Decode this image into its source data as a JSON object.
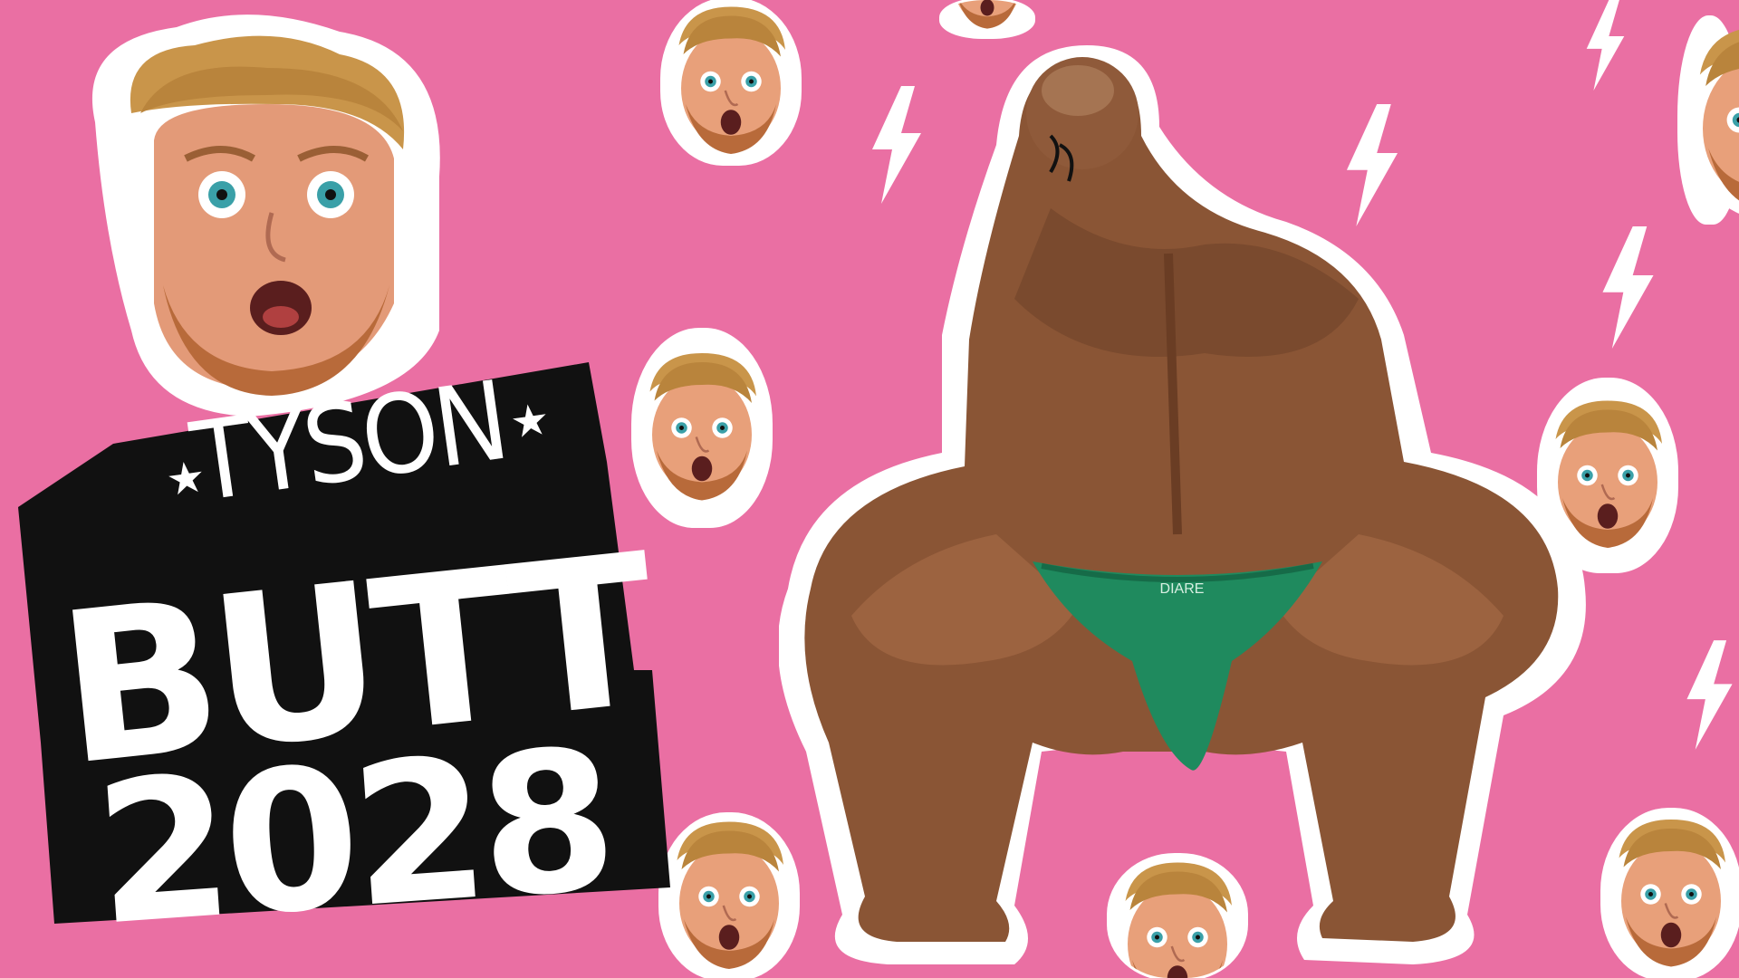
{
  "title": {
    "line1": "TYSON",
    "line2": "BUTT",
    "line3": "2028",
    "star_left": "★",
    "star_right": "★"
  },
  "figure": {
    "briefs_label": "DIARE"
  },
  "colors": {
    "background": "#ea6fa3",
    "sticker_outline": "#ffffff",
    "title_text": "#ffffff",
    "title_outline": "#111111",
    "briefs": "#1f8a5e",
    "skin_dark": "#7a4a2e",
    "skin_mid": "#9c6340",
    "hair": "#c9954a",
    "beard": "#b86a3a"
  },
  "decorations": {
    "bolt_icon": "lightning-bolt-icon",
    "face_icon": "surprised-face-icon"
  }
}
